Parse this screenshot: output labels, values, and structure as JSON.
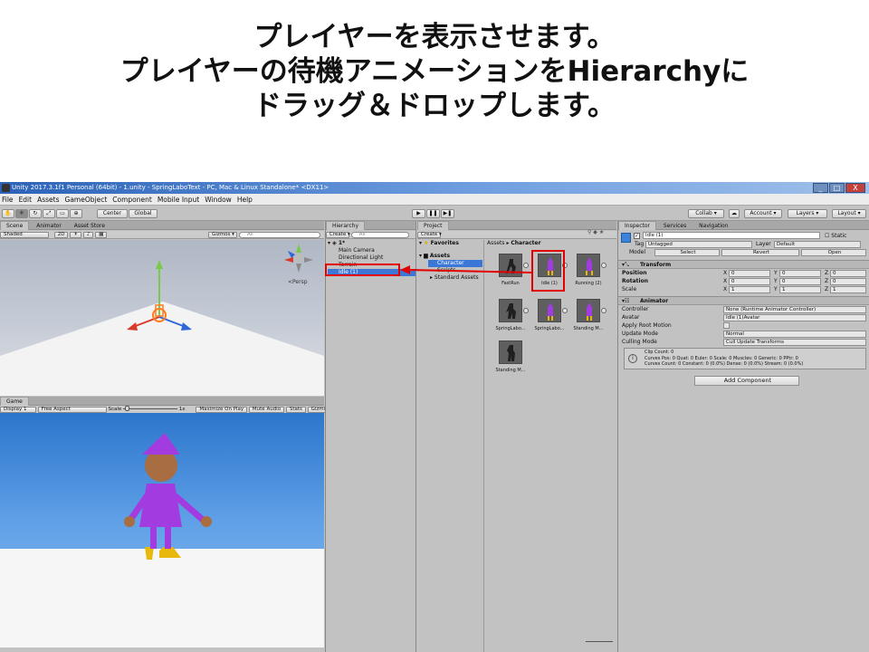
{
  "slide": {
    "title_lines": [
      "プレイヤーを表示させます。",
      "プレイヤーの待機アニメーションをHierarchyに",
      "ドラッグ＆ドロップします。"
    ]
  },
  "window": {
    "title": "Unity 2017.3.1f1 Personal (64bit) - 1.unity - SpringLaboText - PC, Mac & Linux Standalone* <DX11>",
    "buttons": [
      "_",
      "□",
      "X"
    ]
  },
  "menu": [
    "File",
    "Edit",
    "Assets",
    "GameObject",
    "Component",
    "Mobile Input",
    "Window",
    "Help"
  ],
  "toolbar": {
    "pivot": "Center",
    "space": "Global",
    "collab": "Collab ▾",
    "account": "Account ▾",
    "layers": "Layers ▾",
    "layout": "Layout ▾"
  },
  "scene": {
    "tabs": [
      "Scene",
      "Animator",
      "Asset Store"
    ],
    "shading": "Shaded",
    "mode_2d": "2D",
    "gizmos": "Gizmos ▾",
    "search_prefix": "All",
    "persp": "<Persp"
  },
  "game": {
    "tab": "Game",
    "display": "Display 1",
    "aspect": "Free Aspect",
    "scale_label": "Scale",
    "scale_value": "1x",
    "options": [
      "Maximize On Play",
      "Mute Audio",
      "Stats",
      "Gizmos ▾"
    ]
  },
  "hierarchy": {
    "tab": "Hierarchy",
    "create": "Create ▾",
    "search_prefix": "All",
    "scene_name": "1*",
    "items": [
      "Main Camera",
      "Directional Light",
      "Terrain",
      "Idle (1)"
    ]
  },
  "project": {
    "tab": "Project",
    "create": "Create ▾",
    "favorites": "Favorites",
    "assets": "Assets",
    "folders": [
      "Character",
      "Scripts",
      "Standard Assets"
    ],
    "breadcrumb": [
      "Assets",
      "Character"
    ],
    "thumbnails": [
      "FastRun",
      "Idle (1)",
      "Running (2)",
      "SpringLabo...",
      "SpringLabo...",
      "Standing M...",
      "Standing M..."
    ]
  },
  "inspector": {
    "tabs": [
      "Inspector",
      "Services",
      "Navigation"
    ],
    "object_name": "Idle (1)",
    "static_label": "Static",
    "tag_label": "Tag",
    "tag_value": "Untagged",
    "layer_label": "Layer",
    "layer_value": "Default",
    "model_label": "Model",
    "model_buttons": [
      "Select",
      "Revert",
      "Open"
    ],
    "transform": {
      "title": "Transform",
      "rows": [
        {
          "label": "Position",
          "x": "0",
          "y": "0",
          "z": "0"
        },
        {
          "label": "Rotation",
          "x": "0",
          "y": "0",
          "z": "0"
        },
        {
          "label": "Scale",
          "x": "1",
          "y": "1",
          "z": "1"
        }
      ]
    },
    "animator": {
      "title": "Animator",
      "rows": [
        {
          "label": "Controller",
          "value": "None (Runtime Animator Controller)"
        },
        {
          "label": "Avatar",
          "value": "Idle (1)Avatar"
        },
        {
          "label": "Apply Root Motion",
          "value": ""
        },
        {
          "label": "Update Mode",
          "value": "Normal"
        },
        {
          "label": "Culling Mode",
          "value": "Cull Update Transforms"
        }
      ],
      "info_lines": [
        "Clip Count: 0",
        "Curves Pos: 0 Quat: 0 Euler: 0 Scale: 0 Muscles: 0 Generic: 0 PPtr: 0",
        "Curves Count: 0 Constant: 0 (0.0%) Dense: 0 (0.0%) Stream: 0 (0.0%)"
      ]
    },
    "add_component": "Add Component"
  },
  "colors": {
    "highlight": "#e20000",
    "selection": "#3c77d8",
    "character": "#a23be0"
  }
}
